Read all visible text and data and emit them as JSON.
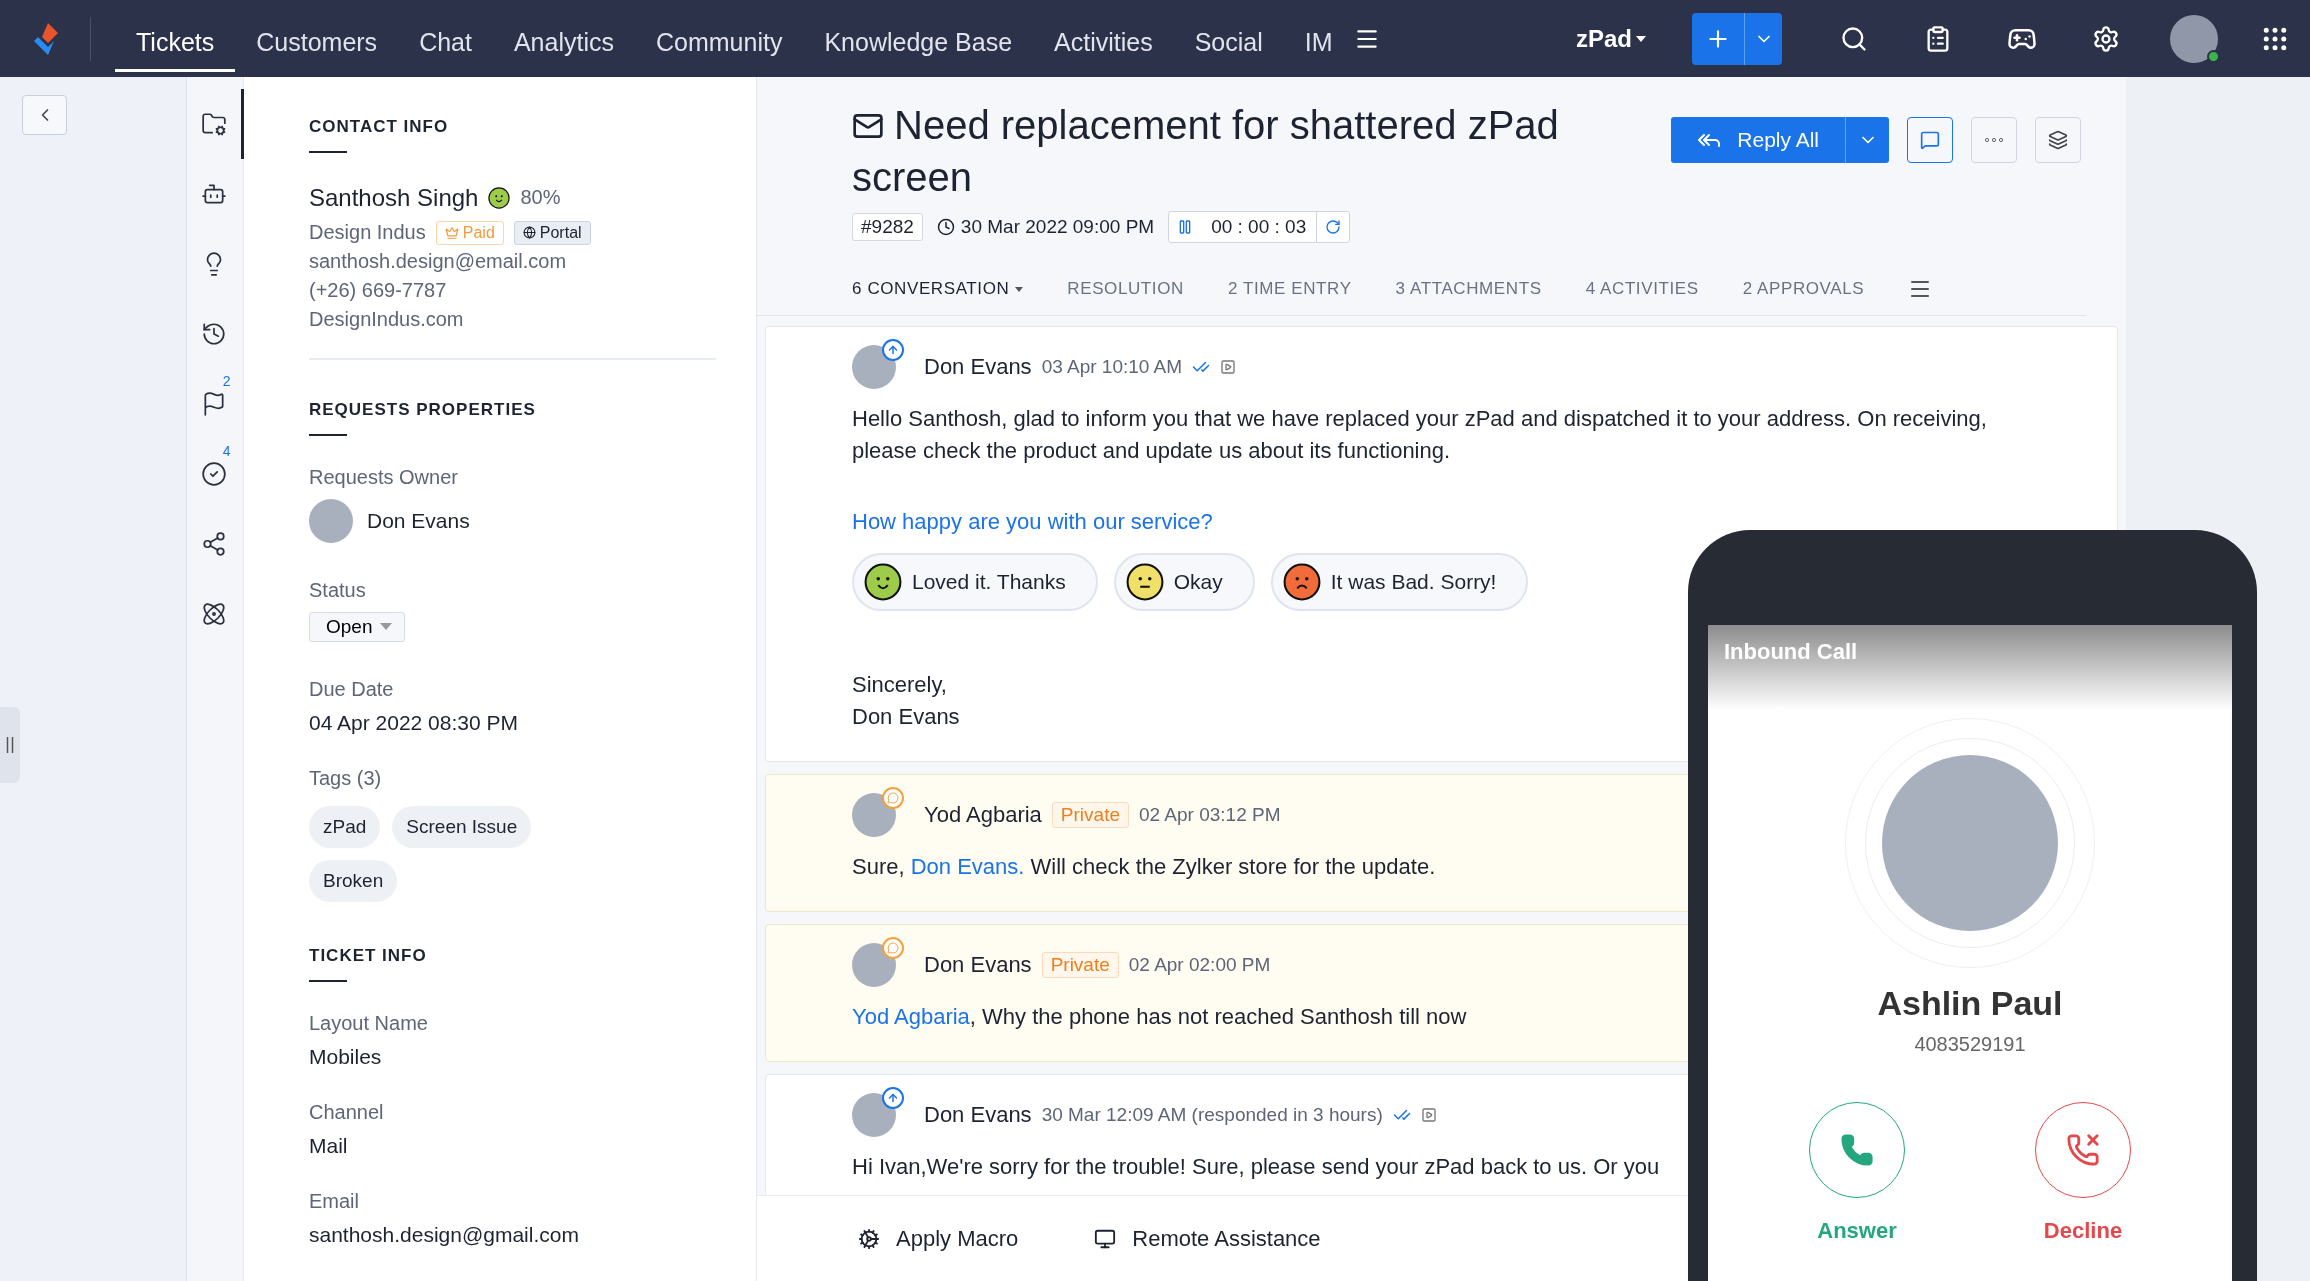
{
  "nav": {
    "items": [
      {
        "label": "Tickets",
        "selected": true
      },
      {
        "label": "Customers",
        "selected": false
      },
      {
        "label": "Chat",
        "selected": false
      },
      {
        "label": "Analytics",
        "selected": false
      },
      {
        "label": "Community",
        "selected": false
      },
      {
        "label": "Knowledge Base",
        "selected": false
      },
      {
        "label": "Activities",
        "selected": false
      },
      {
        "label": "Social",
        "selected": false
      },
      {
        "label": "IM",
        "selected": false
      }
    ],
    "department": "zPad"
  },
  "sidebar_icons": [
    {
      "kind": "folder-gear",
      "selected": true
    },
    {
      "kind": "robot",
      "selected": false
    },
    {
      "kind": "bulb",
      "selected": false
    },
    {
      "kind": "history",
      "selected": false
    },
    {
      "kind": "flag",
      "selected": false,
      "badge": "2"
    },
    {
      "kind": "check",
      "selected": false,
      "badge": "4"
    },
    {
      "kind": "share",
      "selected": false
    },
    {
      "kind": "atom",
      "selected": false
    }
  ],
  "contact": {
    "heading": "CONTACT INFO",
    "name": "Santhosh Singh",
    "happiness": "80%",
    "company": "Design Indus",
    "badges": [
      {
        "label": "Paid",
        "kind": "paid"
      },
      {
        "label": "Portal",
        "kind": "portal"
      }
    ],
    "email": "santhosh.design@email.com",
    "phone": "(+26) 669-7787",
    "website": "DesignIndus.com"
  },
  "properties": {
    "heading": "REQUESTS PROPERTIES",
    "owner_label": "Requests Owner",
    "owner": "Don Evans",
    "status_label": "Status",
    "status": "Open",
    "due_label": "Due Date",
    "due": "04 Apr 2022 08:30 PM",
    "tags_label": "Tags (3)",
    "tags": [
      "zPad",
      "Screen Issue",
      "Broken"
    ]
  },
  "ticket_info": {
    "heading": "TICKET INFO",
    "fields": [
      {
        "label": "Layout Name",
        "value": "Mobiles"
      },
      {
        "label": "Channel",
        "value": "Mail"
      },
      {
        "label": "Email",
        "value": "santhosh.design@gmail.com"
      }
    ]
  },
  "ticket": {
    "title": "Need replacement for shattered zPad screen",
    "id": "#9282",
    "created": "30 Mar 2022 09:00 PM",
    "timer": "00 : 00 : 03",
    "reply": "Reply All",
    "tabs": [
      {
        "label": "6 CONVERSATION",
        "selected": true
      },
      {
        "label": "RESOLUTION",
        "selected": false
      },
      {
        "label": "2 TIME ENTRY",
        "selected": false
      },
      {
        "label": "3 ATTACHMENTS",
        "selected": false
      },
      {
        "label": "4 ACTIVITIES",
        "selected": false
      },
      {
        "label": "2 APPROVALS",
        "selected": false
      }
    ]
  },
  "threads": [
    {
      "kind": "reply",
      "author": "Don Evans",
      "time": "03 Apr 10:10 AM",
      "body": [
        {
          "text": "Hello Santhosh, glad to inform you that we have replaced your zPad and dispatched it to your address. On receiving, please check the product and update us about its functioning.",
          "link": false
        }
      ],
      "survey": {
        "question": "How happy are you with our service?",
        "options": [
          {
            "label": "Loved it. Thanks",
            "kind": "happy"
          },
          {
            "label": "Okay",
            "kind": "neutral"
          },
          {
            "label": "It was Bad. Sorry!",
            "kind": "sad"
          }
        ]
      },
      "signoff": [
        "Sincerely,",
        "Don Evans"
      ]
    },
    {
      "kind": "private",
      "author": "Yod Agbaria",
      "badge": "Private",
      "time": "02 Apr 03:12 PM",
      "body": [
        {
          "text": "Sure, ",
          "link": false
        },
        {
          "text": "Don Evans.",
          "link": true
        },
        {
          "text": " Will check the Zylker store for the update.",
          "link": false
        }
      ]
    },
    {
      "kind": "private",
      "author": "Don Evans",
      "badge": "Private",
      "time": "02 Apr 02:00 PM",
      "body": [
        {
          "text": "Yod Agbaria",
          "link": true
        },
        {
          "text": ",  Why the phone has not reached Santhosh till now",
          "link": false
        }
      ]
    },
    {
      "kind": "reply",
      "author": "Don Evans",
      "time": "30 Mar 12:09 AM (responded in 3 hours)",
      "body": [
        {
          "text": "Hi Ivan,We're sorry for the trouble! Sure, please send your zPad back to us. Or you",
          "link": false
        }
      ]
    }
  ],
  "footer_actions": [
    {
      "label": "Apply Macro",
      "kind": "macro"
    },
    {
      "label": "Remote Assistance",
      "kind": "remote"
    }
  ],
  "call": {
    "title": "Inbound Call",
    "name": "Ashlin Paul",
    "number": "4083529191",
    "answer": "Answer",
    "decline": "Decline"
  }
}
